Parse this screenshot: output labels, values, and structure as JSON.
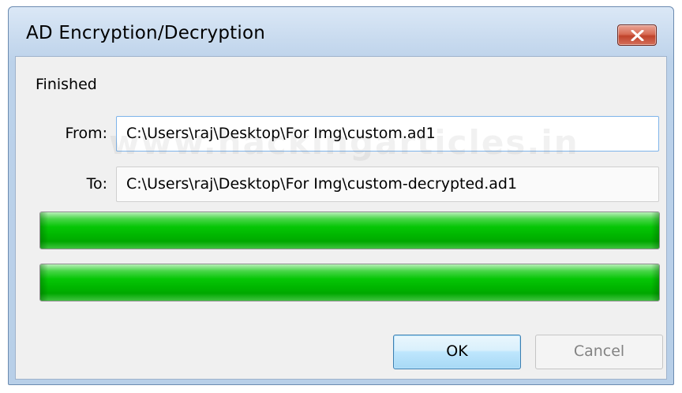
{
  "window": {
    "title": "AD Encryption/Decryption",
    "close_icon": "close-x-icon"
  },
  "status": "Finished",
  "from": {
    "label": "From:",
    "path": "C:\\Users\\raj\\Desktop\\For Img\\custom.ad1"
  },
  "to": {
    "label": "To:",
    "path": "C:\\Users\\raj\\Desktop\\For Img\\custom-decrypted.ad1"
  },
  "watermark": "www.hackingarticles.in",
  "progress": [
    {
      "value": 1.0
    },
    {
      "value": 1.0
    }
  ],
  "buttons": {
    "ok": "OK",
    "cancel": "Cancel"
  },
  "colors": {
    "progress_fill": "#00b700",
    "close_button": "#c0432b"
  }
}
